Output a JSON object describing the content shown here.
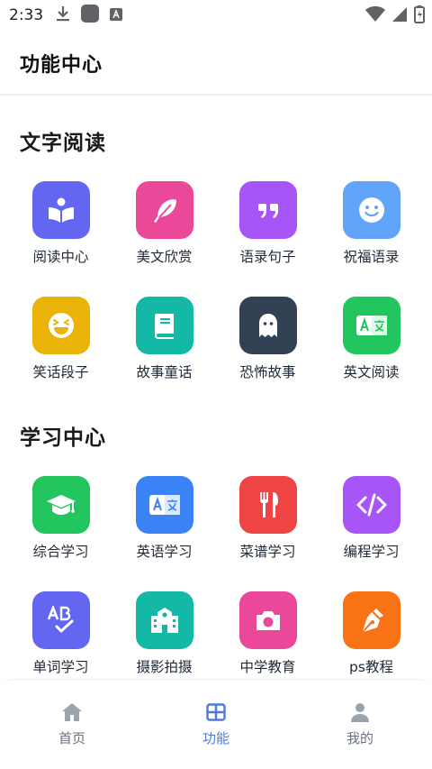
{
  "status_bar": {
    "time": "2:33"
  },
  "header": {
    "title": "功能中心"
  },
  "sections": [
    {
      "title": "文字阅读",
      "items": [
        {
          "label": "阅读中心",
          "icon": "book-open-reader-icon",
          "color": "#6366f1"
        },
        {
          "label": "美文欣赏",
          "icon": "feather-icon",
          "color": "#ec4899"
        },
        {
          "label": "语录句子",
          "icon": "quote-icon",
          "color": "#a855f7"
        },
        {
          "label": "祝福语录",
          "icon": "smile-icon",
          "color": "#60a5fa"
        },
        {
          "label": "笑话段子",
          "icon": "laugh-squint-icon",
          "color": "#eab308"
        },
        {
          "label": "故事童话",
          "icon": "book-icon",
          "color": "#14b8a6"
        },
        {
          "label": "恐怖故事",
          "icon": "ghost-icon",
          "color": "#334155"
        },
        {
          "label": "英文阅读",
          "icon": "language-icon",
          "color": "#22c55e"
        }
      ]
    },
    {
      "title": "学习中心",
      "items": [
        {
          "label": "综合学习",
          "icon": "graduation-cap-icon",
          "color": "#22c55e"
        },
        {
          "label": "英语学习",
          "icon": "language-icon",
          "color": "#3b82f6"
        },
        {
          "label": "菜谱学习",
          "icon": "utensils-icon",
          "color": "#ef4444"
        },
        {
          "label": "编程学习",
          "icon": "code-icon",
          "color": "#a855f7"
        },
        {
          "label": "单词学习",
          "icon": "spell-check-icon",
          "color": "#6366f1"
        },
        {
          "label": "摄影拍摄",
          "icon": "school-icon",
          "color": "#14b8a6"
        },
        {
          "label": "中学教育",
          "icon": "camera-icon",
          "color": "#ec4899"
        },
        {
          "label": "ps教程",
          "icon": "pen-nib-icon",
          "color": "#f97316"
        }
      ]
    }
  ],
  "bottom_nav": {
    "items": [
      {
        "label": "首页",
        "icon": "home-icon"
      },
      {
        "label": "功能",
        "icon": "grid-icon",
        "active": true
      },
      {
        "label": "我的",
        "icon": "user-icon"
      }
    ],
    "active_color": "#4f7ad9",
    "inactive_color": "#9ca3af"
  }
}
